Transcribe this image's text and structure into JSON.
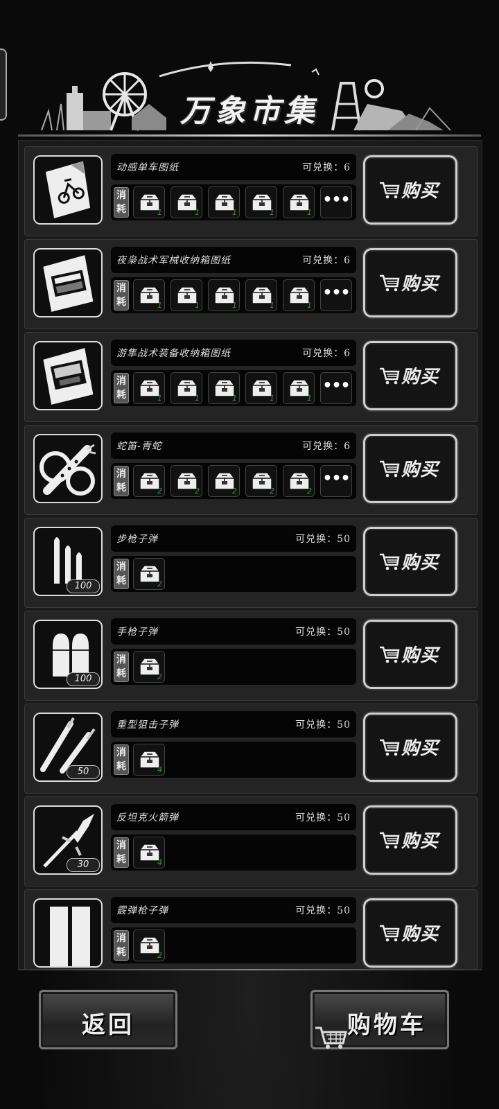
{
  "header": {
    "title": "万象市集"
  },
  "list": {
    "items": [
      {
        "name": "动感单车图纸",
        "stock_label": "可兑换：",
        "stock": "6",
        "thumb": "blueprint-bike-icon",
        "qty": "",
        "mats": [
          "1",
          "1",
          "1",
          "1",
          "1"
        ],
        "has_more": true
      },
      {
        "name": "夜枭战术军械收纳箱图纸",
        "stock_label": "可兑换：",
        "stock": "6",
        "thumb": "blueprint-crate-icon",
        "qty": "",
        "mats": [
          "1",
          "1",
          "1",
          "1",
          "1"
        ],
        "has_more": true
      },
      {
        "name": "游隼战术装备收纳箱图纸",
        "stock_label": "可兑换：",
        "stock": "6",
        "thumb": "blueprint-case-icon",
        "qty": "",
        "mats": [
          "1",
          "1",
          "1",
          "1",
          "1"
        ],
        "has_more": true
      },
      {
        "name": "蛇笛-青蛇",
        "stock_label": "可兑换：",
        "stock": "6",
        "thumb": "snake-flute-icon",
        "qty": "",
        "mats": [
          "2",
          "2",
          "2",
          "2",
          "2"
        ],
        "has_more": true
      },
      {
        "name": "步枪子弹",
        "stock_label": "可兑换：",
        "stock": "50",
        "thumb": "rifle-ammo-icon",
        "qty": "100",
        "mats": [
          "2"
        ],
        "has_more": false
      },
      {
        "name": "手枪子弹",
        "stock_label": "可兑换：",
        "stock": "50",
        "thumb": "pistol-ammo-icon",
        "qty": "100",
        "mats": [
          "2"
        ],
        "has_more": false
      },
      {
        "name": "重型狙击子弹",
        "stock_label": "可兑换：",
        "stock": "50",
        "thumb": "sniper-ammo-icon",
        "qty": "50",
        "mats": [
          "4"
        ],
        "has_more": false
      },
      {
        "name": "反坦克火箭弹",
        "stock_label": "可兑换：",
        "stock": "50",
        "thumb": "rocket-icon",
        "qty": "30",
        "mats": [
          "4"
        ],
        "has_more": false
      },
      {
        "name": "霰弹枪子弹",
        "stock_label": "可兑换：",
        "stock": "50",
        "thumb": "shotgun-ammo-icon",
        "qty": "",
        "mats": [
          "2"
        ],
        "has_more": false
      }
    ],
    "consume_label": "消耗",
    "buy_label": "购买",
    "more_label": "•••"
  },
  "footer": {
    "back_label": "返回",
    "cart_label": "购物车"
  },
  "colors": {
    "mat_count": "#3c8f3c",
    "accent_border": "#d0d0d0"
  }
}
